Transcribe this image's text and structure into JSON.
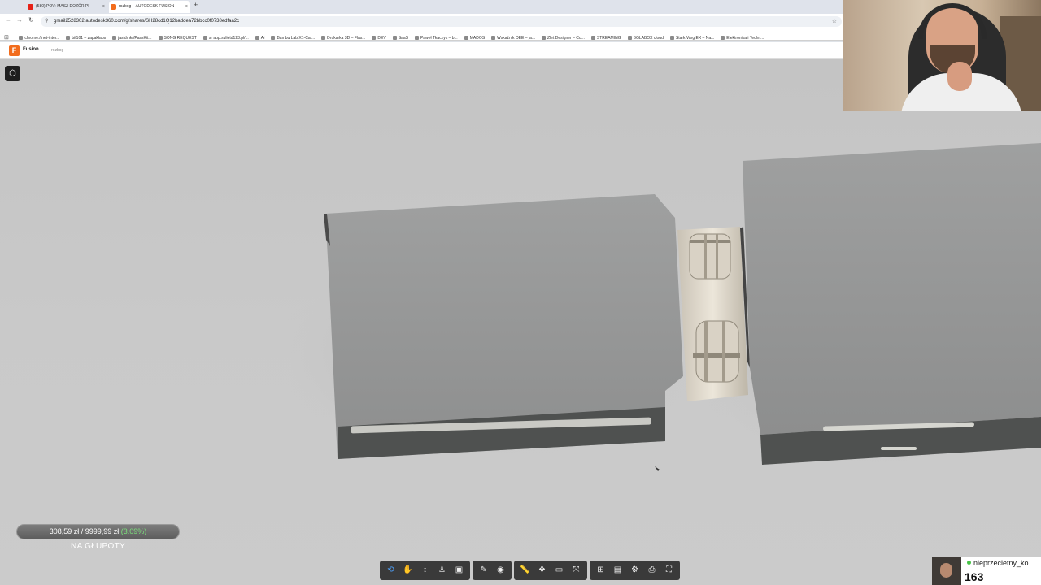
{
  "browser": {
    "tabs": [
      {
        "title": "(580) POV: MASZ DOZÓR PI",
        "favicon_color": "#e62117",
        "active": false
      },
      {
        "title": "rozbog – AUTODESK FUSION",
        "favicon_color": "#f26c1c",
        "active": true
      }
    ],
    "url": "gmail2528302.autodesk360.com/g/shares/SH28cd1Q12baddea72bbcc0f0738edfaa2c",
    "bookmarks": [
      "chrome://net-inter...",
      "bit101 – zapaklabs",
      "jastdmkr/PassKit...",
      "SONG REQUEST",
      "sr app.sulietd123.pl/...",
      "AI",
      "Bambu Lab X1-Car...",
      "Drukarka 3D – Flas...",
      "DEV",
      "SaaS",
      "Paweł Tkaczyk – b...",
      "MADOS",
      "Wskaźnik OEE – ja...",
      "Zlet Designer – Co...",
      "STREAMING",
      "BGLABOX cloud",
      "Stark Varg EX – Na...",
      "Elektronika i Techn..."
    ]
  },
  "fusion": {
    "app_name": "Fusion",
    "model_name": "rozbog",
    "brand_color": "#f26c1c"
  },
  "overlay": {
    "donation_text": "308,59 zł / 9999,99 zł",
    "donation_pct": "(3.09%)",
    "donation_progress": 0.0309,
    "donation_label": "NA GŁUPOTY",
    "viewer_name": "nieprzecietny_ko",
    "viewer_count": "163"
  },
  "toolbar": {
    "groups": [
      [
        "orbit-icon",
        "pan-icon",
        "zoom-icon",
        "walk-icon",
        "camera-icon"
      ],
      [
        "markup-icon",
        "visibility-icon"
      ],
      [
        "measure-icon",
        "explode-icon",
        "section-icon",
        "fit-icon"
      ],
      [
        "model-browser-icon",
        "properties-icon",
        "settings-icon",
        "print-icon",
        "fullscreen-icon"
      ]
    ],
    "glyphs": {
      "orbit-icon": "⟲",
      "pan-icon": "✋",
      "zoom-icon": "↕",
      "walk-icon": "♙",
      "camera-icon": "▣",
      "markup-icon": "✎",
      "visibility-icon": "◉",
      "measure-icon": "📏",
      "explode-icon": "❖",
      "section-icon": "▭",
      "fit-icon": "⤧",
      "model-browser-icon": "⊞",
      "properties-icon": "▤",
      "settings-icon": "⚙",
      "print-icon": "⎙",
      "fullscreen-icon": "⛶"
    }
  }
}
